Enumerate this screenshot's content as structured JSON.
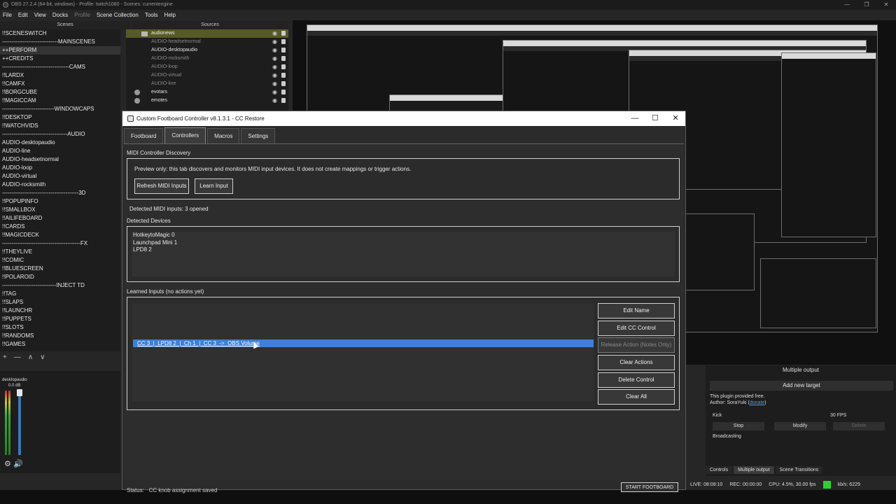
{
  "obs": {
    "window_title": "OBS 27.2.4 (64-bit, windows) - Profile: twitch1080 - Scenes: currentengine",
    "window_buttons": [
      "—",
      "❐",
      "✕"
    ],
    "menu": [
      "File",
      "Edit",
      "View",
      "Docks",
      "Profile",
      "Scene Collection",
      "Tools",
      "Help"
    ],
    "scenes_title": "Scenes",
    "sources_title": "Sources",
    "scenes": [
      "!!SCENESWITCH",
      "------------------------------MAINSCENES",
      "++PERFORM",
      "++CREDITS",
      "------------------------------------CAMS",
      "!!LARDX",
      "!!CAMFX",
      "!!BORGCUBE",
      "!!MAGICCAM",
      "----------------------------WINDOWCAPS",
      "!!DESKTOP",
      "!!WATCHVIDS",
      "-----------------------------------AUDIO",
      "AUDIO-desktopaudio",
      "AUDIO-line",
      "AUDIO-headsetnormal",
      "AUDIO-loop",
      "AUDIO-virtual",
      "AUDIO-rocksmith",
      "-----------------------------------------3D",
      "!!POPUPINFO",
      "!!SMALLBOX",
      "!!AILIFEBOARD",
      "!!CARDS",
      "!!MAGICDECK",
      "------------------------------------------FX",
      "!!THEYLIVE",
      "!!COMIC",
      "!!BLUESCREEN",
      "!!POLAROID",
      "-----------------------------INJECT TD",
      "!!TAG",
      "!!SLAPS",
      "!!LAUNCHR",
      "!!PUPPETS",
      "!!SLOTS",
      "!!RANDOMS",
      "!!GAMES"
    ],
    "scene_tools": [
      "+",
      "—",
      "∧",
      "∨"
    ],
    "sources": [
      {
        "name": "audionews",
        "type": "folder"
      },
      {
        "name": "AUDIO-headsetnormal",
        "type": "item"
      },
      {
        "name": "AUDIO-desktopaudio",
        "type": "item"
      },
      {
        "name": "AUDIO-rocksmith",
        "type": "item"
      },
      {
        "name": "AUDIO-loop",
        "type": "item"
      },
      {
        "name": "AUDIO-virtual",
        "type": "item"
      },
      {
        "name": "AUDIO-line",
        "type": "item"
      },
      {
        "name": "evotars",
        "type": "group"
      },
      {
        "name": "emotes",
        "type": "group"
      }
    ],
    "mixer": {
      "source": "desktopaudio",
      "level": "0.0 dB"
    },
    "multiple_output": {
      "title": "Multiple output",
      "add_target": "Add new target",
      "free_note": "This plugin provided free.",
      "author_prefix": "Author: SoraYuki (",
      "author_link": "donate",
      "author_suffix": ")",
      "target_name": "Kick",
      "target_fps": "30 FPS",
      "stop": "Stop",
      "modify": "Modify",
      "delete": "Delete",
      "broadcasting": "Broadcasting"
    },
    "bottom_tabs": [
      "Controls",
      "Multiple output",
      "Scene Transitions"
    ],
    "status": {
      "live": "LIVE: 08:08:10",
      "rec": "REC: 00:00:00",
      "cpu": "CPU: 4.5%, 30.00 fps",
      "kbps": "kb/s: 6229"
    }
  },
  "dialog": {
    "title": "Custom Footboard Controller v8.1.3.1 - CC Restore",
    "buttons": {
      "minimize": "—",
      "maximize": "☐",
      "close": "✕"
    },
    "tabs": [
      "Footboard",
      "Controllers",
      "Macros",
      "Settings"
    ],
    "discovery_title": "MIDI Controller Discovery",
    "preview_note": "Preview only: this tab discovers and monitors MIDI input devices. It does not create mappings or trigger actions.",
    "refresh_button": "Refresh MIDI Inputs",
    "learn_button": "Learn Input",
    "detected_count": "Detected MIDI inputs: 3 opened",
    "devices_title": "Detected Devices",
    "devices": [
      "HotkeytoMagic 0",
      "Launchpad Mini 1",
      "LPD8 2"
    ],
    "learned_title": "Learned Inputs (no actions yet)",
    "learned_rows": [
      "CC 3  |  LPD8 2  |  Ch 1  |  CC 3  ->  OBS Volume"
    ],
    "actions": {
      "edit_name": "Edit Name",
      "edit_cc": "Edit CC Control",
      "release_action": "Release Action (Notes Only)",
      "clear_actions": "Clear Actions",
      "delete_control": "Delete Control",
      "clear_all": "Clear All"
    },
    "status_text": "Status:   CC knob assignment saved",
    "start_footboard": "START FOOTBOARD"
  }
}
